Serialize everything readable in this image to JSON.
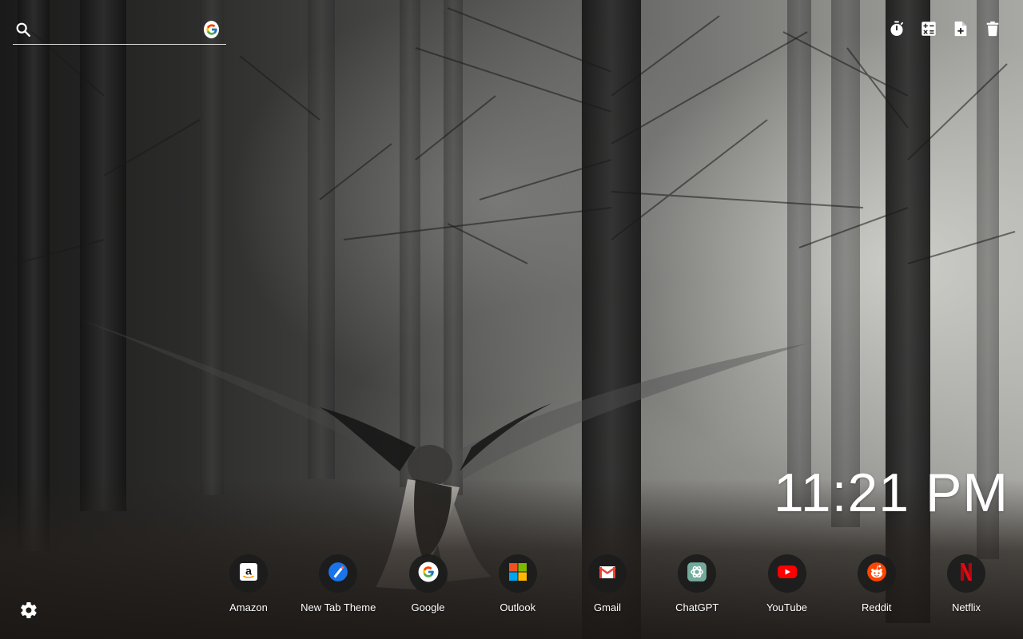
{
  "search": {
    "placeholder": "",
    "value": "",
    "engine_icon": "google-icon"
  },
  "toolbar": {
    "items": [
      {
        "icon": "stopwatch-icon"
      },
      {
        "icon": "calculator-icon"
      },
      {
        "icon": "add-file-icon"
      },
      {
        "icon": "trash-icon"
      }
    ]
  },
  "clock": {
    "time": "11:21 PM"
  },
  "shortcuts": [
    {
      "label": "Amazon",
      "icon": "amazon-icon",
      "color": "#ff9900"
    },
    {
      "label": "New Tab Theme",
      "icon": "new-tab-theme-icon",
      "color": "#1a73e8"
    },
    {
      "label": "Google",
      "icon": "google-icon",
      "color": "#4285f4"
    },
    {
      "label": "Outlook",
      "icon": "microsoft-icon",
      "color": "#f25022"
    },
    {
      "label": "Gmail",
      "icon": "gmail-icon",
      "color": "#ea4335"
    },
    {
      "label": "ChatGPT",
      "icon": "chatgpt-icon",
      "color": "#74aa9c"
    },
    {
      "label": "YouTube",
      "icon": "youtube-icon",
      "color": "#ff0000"
    },
    {
      "label": "Reddit",
      "icon": "reddit-icon",
      "color": "#ff4500"
    },
    {
      "label": "Netflix",
      "icon": "netflix-icon",
      "color": "#e50914"
    }
  ],
  "settings": {
    "icon": "gear-icon"
  }
}
